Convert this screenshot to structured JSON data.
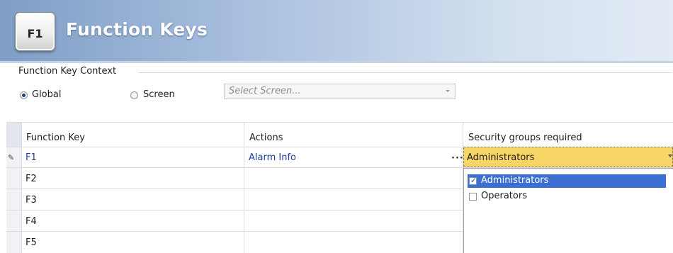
{
  "header": {
    "key_icon": "F1",
    "title": "Function Keys"
  },
  "context": {
    "group_label": "Function Key Context",
    "radio_global": "Global",
    "radio_screen": "Screen",
    "selected": "Global",
    "screen_select_placeholder": "Select Screen..."
  },
  "grid": {
    "columns": [
      "Function Key",
      "Actions",
      "Security groups required"
    ],
    "rows": [
      {
        "key": "F1",
        "action": "Alarm Info",
        "security": "Administrators"
      },
      {
        "key": "F2",
        "action": "",
        "security": ""
      },
      {
        "key": "F3",
        "action": "",
        "security": ""
      },
      {
        "key": "F4",
        "action": "",
        "security": ""
      },
      {
        "key": "F5",
        "action": "",
        "security": ""
      }
    ],
    "ellipsis": "...",
    "security_options": [
      {
        "label": "Administrators",
        "checked": true
      },
      {
        "label": "Operators",
        "checked": false
      }
    ]
  },
  "colors": {
    "header_blue": "#7f9ec6",
    "selected_cell": "#f8d567",
    "selection": "#3d6fd1",
    "link_blue": "#1b3f9c"
  }
}
